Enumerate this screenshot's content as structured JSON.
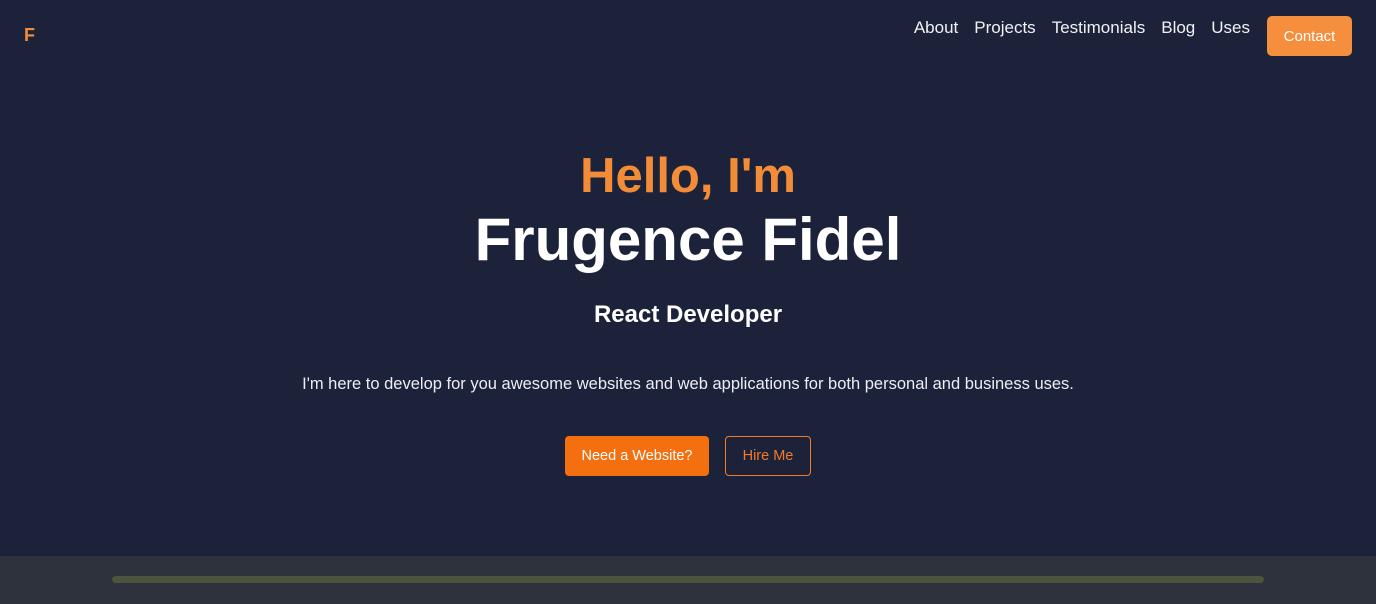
{
  "logo": {
    "text": "F"
  },
  "nav": {
    "items": [
      {
        "label": "About"
      },
      {
        "label": "Projects"
      },
      {
        "label": "Testimonials"
      },
      {
        "label": "Blog"
      },
      {
        "label": "Uses"
      }
    ],
    "contact_label": "Contact"
  },
  "hero": {
    "greeting": "Hello, I'm",
    "name": "Frugence Fidel",
    "role": "React Developer",
    "description": "I'm here to develop for you awesome websites and web applications for both personal and business uses.",
    "primary_button": "Need a Website?",
    "secondary_button": "Hire Me"
  },
  "colors": {
    "background": "#1c2239",
    "accent": "#f28c38",
    "primary_button": "#f46f10",
    "footer_strip": "#2e323c"
  }
}
